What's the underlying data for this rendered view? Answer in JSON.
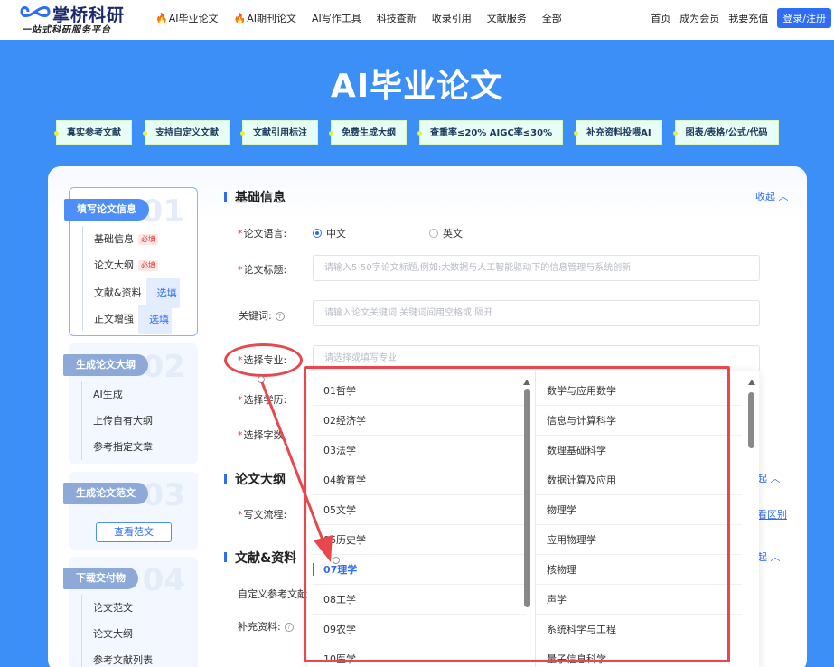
{
  "nav": {
    "logo_title": "掌桥科研",
    "logo_subtitle": "一站式科研服务平台",
    "items": [
      "AI毕业论文",
      "AI期刊论文",
      "AI写作工具",
      "科技查新",
      "收录引用",
      "文献服务",
      "全部"
    ],
    "right_items": [
      "首页",
      "成为会员",
      "我要充值"
    ],
    "login": "登录/注册"
  },
  "hero": {
    "title": "AI毕业论文",
    "tags": [
      "真实参考文献",
      "支持自定义文献",
      "文献引用标注",
      "免费生成大纲",
      "查重率≤20%  AIGC率≤30%",
      "补充资料投喂AI",
      "图表/表格/公式/代码"
    ]
  },
  "steps": [
    {
      "title": "填写论文信息",
      "num": "01",
      "items": [
        {
          "label": "基础信息",
          "badge": "必填"
        },
        {
          "label": "论文大纲",
          "badge": "必填"
        },
        {
          "label": "文献&资料",
          "badge": "选填"
        },
        {
          "label": "正文增强",
          "badge": "选填"
        }
      ]
    },
    {
      "title": "生成论文大纲",
      "num": "02",
      "items": [
        {
          "label": "AI生成"
        },
        {
          "label": "上传自有大纲"
        },
        {
          "label": "参考指定文章"
        }
      ]
    },
    {
      "title": "生成论文范文",
      "num": "03",
      "button": "查看范文"
    },
    {
      "title": "下载交付物",
      "num": "04",
      "items": [
        {
          "label": "论文范文"
        },
        {
          "label": "论文大纲"
        },
        {
          "label": "参考文献列表"
        }
      ]
    }
  ],
  "form": {
    "section_basic": "基础信息",
    "collapse": "收起",
    "language_label": "论文语言:",
    "language_options": [
      "中文",
      "英文"
    ],
    "title_label": "论文标题:",
    "title_placeholder": "请输入5-50字论文标题,例如:大数据与人工智能驱动下的信息管理与系统创新",
    "keywords_label": "关键词:",
    "keywords_placeholder": "请输入论文关键词,关键词间用空格或;隔开",
    "major_label": "选择专业:",
    "major_placeholder": "请选择或填写专业",
    "degree_label": "选择学历:",
    "words_label": "选择字数",
    "section_outline": "论文大纲",
    "flow_label": "写文流程:",
    "collapse_partial": "起",
    "diff_partial": "看区别",
    "section_refs": "文献&资料",
    "custom_refs_label": "自定义参考文献",
    "supplement_label": "补充资料:"
  },
  "dropdown": {
    "left": [
      "01哲学",
      "02经济学",
      "03法学",
      "04教育学",
      "05文学",
      "06历史学",
      "07理学",
      "08工学",
      "09农学",
      "10医学"
    ],
    "selected_index": 6,
    "right": [
      "数学与应用数学",
      "信息与计算科学",
      "数理基础科学",
      "数据计算及应用",
      "物理学",
      "应用物理学",
      "核物理",
      "声学",
      "系统科学与工程",
      "量子信息科学"
    ]
  },
  "colors": {
    "accent": "#2f6df6",
    "annotation": "#e8484d",
    "hero_bg": "#3b8ff7"
  }
}
